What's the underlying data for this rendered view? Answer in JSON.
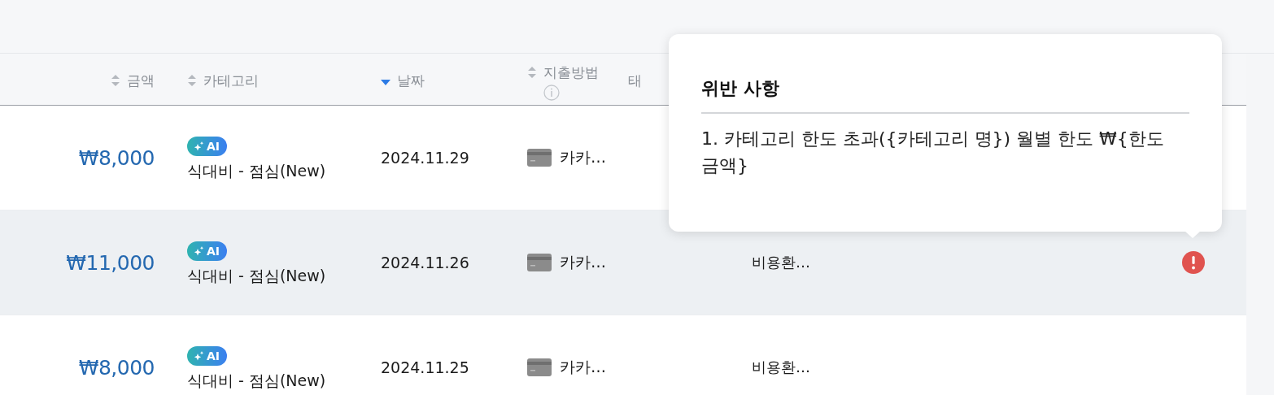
{
  "table": {
    "columns": [
      {
        "label": "금액",
        "sorted": false
      },
      {
        "label": "카테고리",
        "sorted": false
      },
      {
        "label": "날짜",
        "sorted": true
      },
      {
        "label": "지출방법",
        "sorted": false,
        "info": true
      },
      {
        "label": "태"
      }
    ],
    "rows": [
      {
        "amount": "₩8,000",
        "badge": "AI",
        "category": "식대비 - 점심(New)",
        "date": "2024.11.29",
        "payment": "카카…",
        "selected": false,
        "violation": false
      },
      {
        "amount": "₩11,000",
        "badge": "AI",
        "category": "식대비 - 점심(New)",
        "date": "2024.11.26",
        "payment": "카카…",
        "column_6": "비용환…",
        "selected": true,
        "violation": true
      },
      {
        "amount": "₩8,000",
        "badge": "AI",
        "category": "식대비 - 점심(New)",
        "date": "2024.11.25",
        "payment": "카카…",
        "column_6": "비용환…",
        "selected": false,
        "violation": false
      }
    ]
  },
  "tooltip": {
    "title": "위반 사항",
    "text": "1. 카테고리 한도 초과({카테고리 명}) 월별 한도 ₩{한도금액}"
  }
}
